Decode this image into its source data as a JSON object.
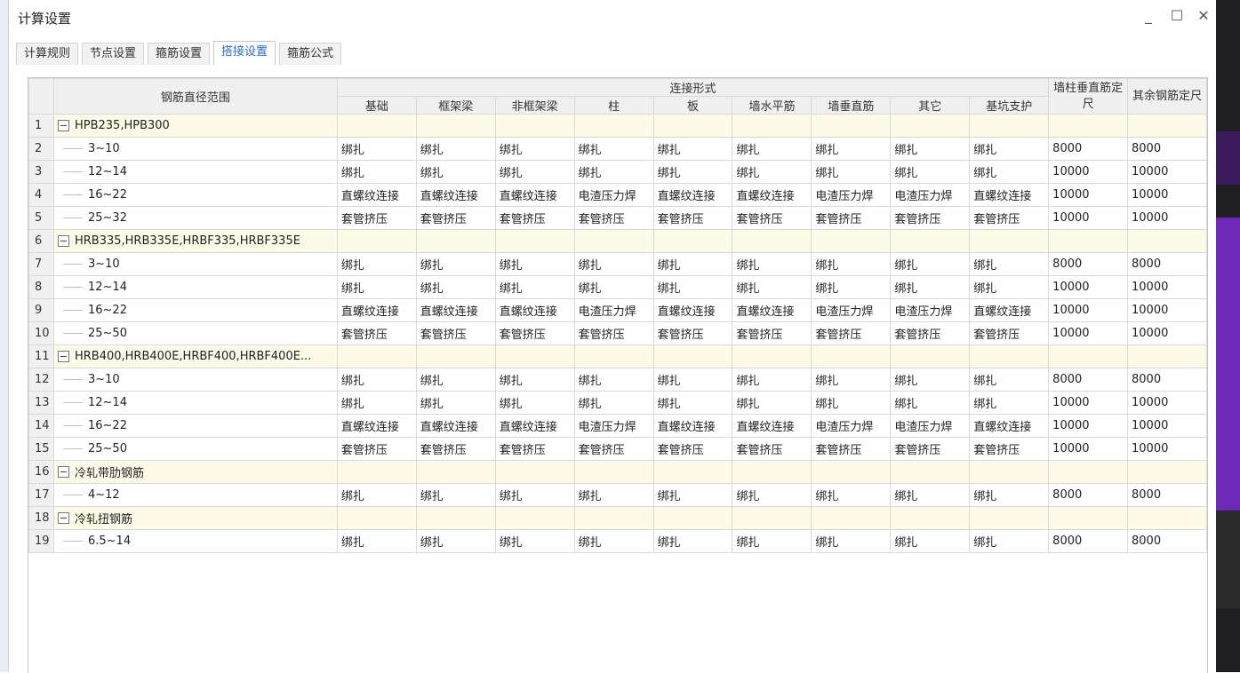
{
  "window": {
    "title": "计算设置",
    "minimize_label": "_",
    "maximize_label": "☐",
    "close_label": "✕"
  },
  "tabs": [
    {
      "label": "计算规则",
      "active": false
    },
    {
      "label": "节点设置",
      "active": false
    },
    {
      "label": "箍筋设置",
      "active": false
    },
    {
      "label": "搭接设置",
      "active": true
    },
    {
      "label": "箍筋公式",
      "active": false
    }
  ],
  "table": {
    "header": {
      "range_label": "钢筋直径范围",
      "group_label": "连接形式",
      "connection_columns": [
        "基础",
        "框架梁",
        "非框架梁",
        "柱",
        "板",
        "墙水平筋",
        "墙垂直筋",
        "其它",
        "基坑支护"
      ],
      "col_wall": "墙柱垂直筋定尺",
      "col_other": "其余钢筋定尺"
    },
    "rows": [
      {
        "no": "1",
        "type": "group",
        "name": "HPB235,HPB300"
      },
      {
        "no": "2",
        "type": "child",
        "name": "3~10",
        "values": [
          "绑扎",
          "绑扎",
          "绑扎",
          "绑扎",
          "绑扎",
          "绑扎",
          "绑扎",
          "绑扎",
          "绑扎"
        ],
        "wall": "8000",
        "other": "8000"
      },
      {
        "no": "3",
        "type": "child",
        "name": "12~14",
        "values": [
          "绑扎",
          "绑扎",
          "绑扎",
          "绑扎",
          "绑扎",
          "绑扎",
          "绑扎",
          "绑扎",
          "绑扎"
        ],
        "wall": "10000",
        "other": "10000"
      },
      {
        "no": "4",
        "type": "child",
        "name": "16~22",
        "values": [
          "直螺纹连接",
          "直螺纹连接",
          "直螺纹连接",
          "电渣压力焊",
          "直螺纹连接",
          "直螺纹连接",
          "电渣压力焊",
          "电渣压力焊",
          "直螺纹连接"
        ],
        "wall": "10000",
        "other": "10000"
      },
      {
        "no": "5",
        "type": "child",
        "name": "25~32",
        "values": [
          "套管挤压",
          "套管挤压",
          "套管挤压",
          "套管挤压",
          "套管挤压",
          "套管挤压",
          "套管挤压",
          "套管挤压",
          "套管挤压"
        ],
        "wall": "10000",
        "other": "10000"
      },
      {
        "no": "6",
        "type": "group",
        "name": "HRB335,HRB335E,HRBF335,HRBF335E"
      },
      {
        "no": "7",
        "type": "child",
        "name": "3~10",
        "values": [
          "绑扎",
          "绑扎",
          "绑扎",
          "绑扎",
          "绑扎",
          "绑扎",
          "绑扎",
          "绑扎",
          "绑扎"
        ],
        "wall": "8000",
        "other": "8000"
      },
      {
        "no": "8",
        "type": "child",
        "name": "12~14",
        "values": [
          "绑扎",
          "绑扎",
          "绑扎",
          "绑扎",
          "绑扎",
          "绑扎",
          "绑扎",
          "绑扎",
          "绑扎"
        ],
        "wall": "10000",
        "other": "10000"
      },
      {
        "no": "9",
        "type": "child",
        "name": "16~22",
        "values": [
          "直螺纹连接",
          "直螺纹连接",
          "直螺纹连接",
          "电渣压力焊",
          "直螺纹连接",
          "直螺纹连接",
          "电渣压力焊",
          "电渣压力焊",
          "直螺纹连接"
        ],
        "wall": "10000",
        "other": "10000"
      },
      {
        "no": "10",
        "type": "child",
        "name": "25~50",
        "values": [
          "套管挤压",
          "套管挤压",
          "套管挤压",
          "套管挤压",
          "套管挤压",
          "套管挤压",
          "套管挤压",
          "套管挤压",
          "套管挤压"
        ],
        "wall": "10000",
        "other": "10000"
      },
      {
        "no": "11",
        "type": "group",
        "name": "HRB400,HRB400E,HRBF400,HRBF400E..."
      },
      {
        "no": "12",
        "type": "child",
        "name": "3~10",
        "values": [
          "绑扎",
          "绑扎",
          "绑扎",
          "绑扎",
          "绑扎",
          "绑扎",
          "绑扎",
          "绑扎",
          "绑扎"
        ],
        "wall": "8000",
        "other": "8000"
      },
      {
        "no": "13",
        "type": "child",
        "name": "12~14",
        "values": [
          "绑扎",
          "绑扎",
          "绑扎",
          "绑扎",
          "绑扎",
          "绑扎",
          "绑扎",
          "绑扎",
          "绑扎"
        ],
        "wall": "10000",
        "other": "10000"
      },
      {
        "no": "14",
        "type": "child",
        "name": "16~22",
        "values": [
          "直螺纹连接",
          "直螺纹连接",
          "直螺纹连接",
          "电渣压力焊",
          "直螺纹连接",
          "直螺纹连接",
          "电渣压力焊",
          "电渣压力焊",
          "直螺纹连接"
        ],
        "wall": "10000",
        "other": "10000"
      },
      {
        "no": "15",
        "type": "child",
        "name": "25~50",
        "values": [
          "套管挤压",
          "套管挤压",
          "套管挤压",
          "套管挤压",
          "套管挤压",
          "套管挤压",
          "套管挤压",
          "套管挤压",
          "套管挤压"
        ],
        "wall": "10000",
        "other": "10000"
      },
      {
        "no": "16",
        "type": "group",
        "name": "冷轧带肋钢筋"
      },
      {
        "no": "17",
        "type": "child",
        "name": "4~12",
        "values": [
          "绑扎",
          "绑扎",
          "绑扎",
          "绑扎",
          "绑扎",
          "绑扎",
          "绑扎",
          "绑扎",
          "绑扎"
        ],
        "wall": "8000",
        "other": "8000"
      },
      {
        "no": "18",
        "type": "group",
        "name": "冷轧扭钢筋"
      },
      {
        "no": "19",
        "type": "child",
        "name": "6.5~14",
        "values": [
          "绑扎",
          "绑扎",
          "绑扎",
          "绑扎",
          "绑扎",
          "绑扎",
          "绑扎",
          "绑扎",
          "绑扎"
        ],
        "wall": "8000",
        "other": "8000"
      }
    ]
  }
}
